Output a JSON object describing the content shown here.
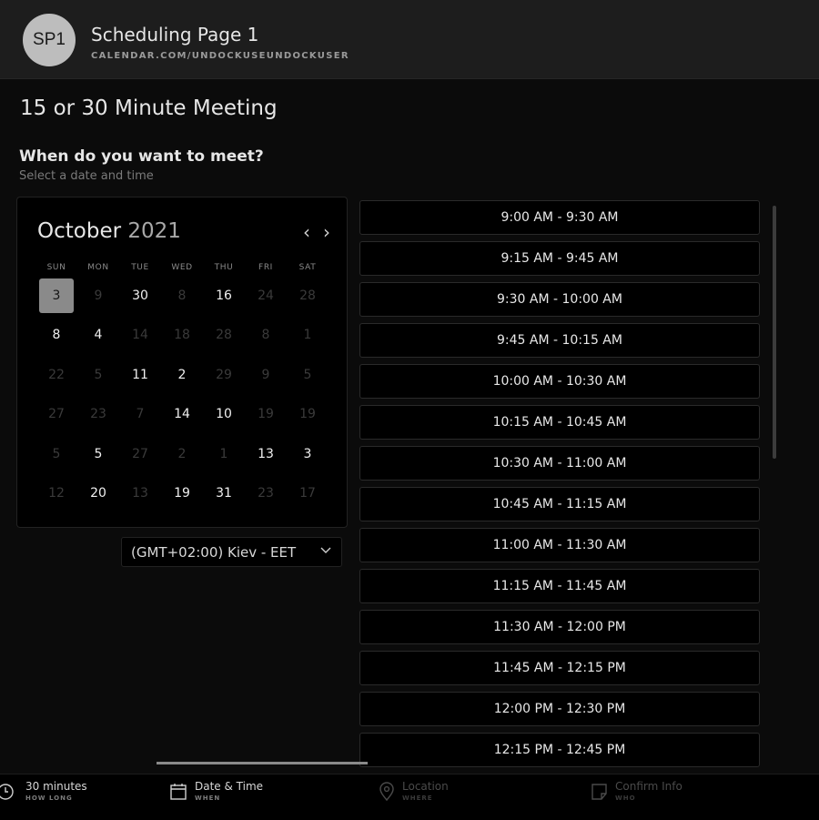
{
  "header": {
    "avatar_initials": "SP1",
    "title": "Scheduling Page 1",
    "url": "CALENDAR.COM/UNDOCKUSEUNDOCKUSER"
  },
  "meeting_title": "15 or 30 Minute Meeting",
  "prompt": {
    "title": "When do you want to meet?",
    "subtitle": "Select a date and time"
  },
  "calendar": {
    "month": "October",
    "year": "2021",
    "prev_icon": "‹",
    "next_icon": "›",
    "weekdays": [
      "SUN",
      "MON",
      "TUE",
      "WED",
      "THU",
      "FRI",
      "SAT"
    ],
    "weeks": [
      [
        {
          "d": "3",
          "s": "selected"
        },
        {
          "d": "9",
          "s": "muted"
        },
        {
          "d": "30",
          "s": "active"
        },
        {
          "d": "8",
          "s": "muted"
        },
        {
          "d": "16",
          "s": "active"
        },
        {
          "d": "24",
          "s": "muted"
        },
        {
          "d": "28",
          "s": "muted"
        }
      ],
      [
        {
          "d": "8",
          "s": "active"
        },
        {
          "d": "4",
          "s": "active"
        },
        {
          "d": "14",
          "s": "muted"
        },
        {
          "d": "18",
          "s": "muted"
        },
        {
          "d": "28",
          "s": "muted"
        },
        {
          "d": "8",
          "s": "muted"
        },
        {
          "d": "1",
          "s": "muted"
        }
      ],
      [
        {
          "d": "22",
          "s": "muted"
        },
        {
          "d": "5",
          "s": "muted"
        },
        {
          "d": "11",
          "s": "active"
        },
        {
          "d": "2",
          "s": "active"
        },
        {
          "d": "29",
          "s": "muted"
        },
        {
          "d": "9",
          "s": "muted"
        },
        {
          "d": "5",
          "s": "muted"
        }
      ],
      [
        {
          "d": "27",
          "s": "muted"
        },
        {
          "d": "23",
          "s": "muted"
        },
        {
          "d": "7",
          "s": "muted"
        },
        {
          "d": "14",
          "s": "active"
        },
        {
          "d": "10",
          "s": "active"
        },
        {
          "d": "19",
          "s": "muted"
        },
        {
          "d": "19",
          "s": "muted"
        }
      ],
      [
        {
          "d": "5",
          "s": "muted"
        },
        {
          "d": "5",
          "s": "active"
        },
        {
          "d": "27",
          "s": "muted"
        },
        {
          "d": "2",
          "s": "muted"
        },
        {
          "d": "1",
          "s": "muted"
        },
        {
          "d": "13",
          "s": "active"
        },
        {
          "d": "3",
          "s": "active"
        }
      ],
      [
        {
          "d": "12",
          "s": "muted"
        },
        {
          "d": "20",
          "s": "active"
        },
        {
          "d": "13",
          "s": "muted"
        },
        {
          "d": "19",
          "s": "active"
        },
        {
          "d": "31",
          "s": "active"
        },
        {
          "d": "23",
          "s": "muted"
        },
        {
          "d": "17",
          "s": "muted"
        }
      ]
    ]
  },
  "timezone": {
    "selected": "(GMT+02:00) Kiev - EET",
    "chevron_icon": "chevron-down-icon"
  },
  "time_slots": [
    "9:00 AM - 9:30 AM",
    "9:15 AM - 9:45 AM",
    "9:30 AM - 10:00 AM",
    "9:45 AM - 10:15 AM",
    "10:00 AM - 10:30 AM",
    "10:15 AM - 10:45 AM",
    "10:30 AM - 11:00 AM",
    "10:45 AM - 11:15 AM",
    "11:00 AM - 11:30 AM",
    "11:15 AM - 11:45 AM",
    "11:30 AM - 12:00 PM",
    "11:45 AM - 12:15 PM",
    "12:00 PM - 12:30 PM",
    "12:15 PM - 12:45 PM"
  ],
  "footer": {
    "steps": [
      {
        "label": "30 minutes",
        "sub": "HOW LONG",
        "icon": "clock-icon"
      },
      {
        "label": "Date & Time",
        "sub": "WHEN",
        "icon": "calendar-icon"
      },
      {
        "label": "Location",
        "sub": "WHERE",
        "icon": "location-pin-icon"
      },
      {
        "label": "Confirm Info",
        "sub": "WHO",
        "icon": "note-icon"
      }
    ]
  }
}
